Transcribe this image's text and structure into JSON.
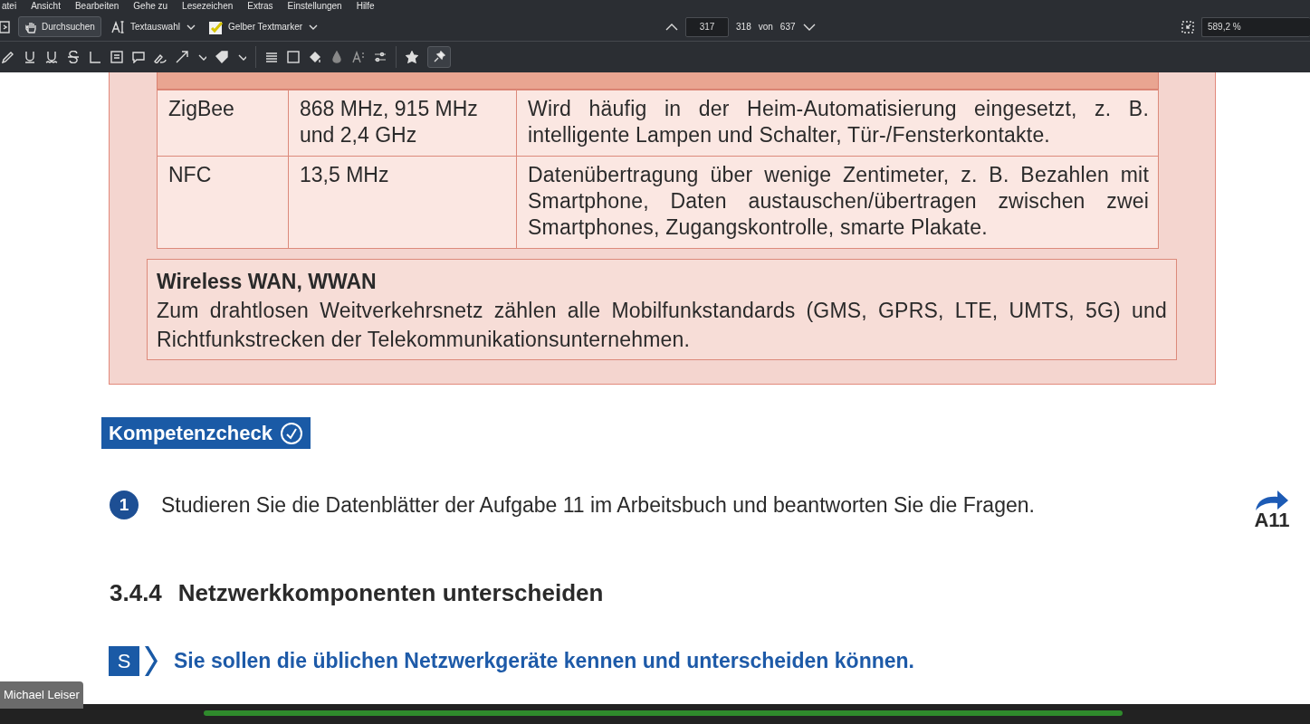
{
  "menu": [
    "atei",
    "Ansicht",
    "Bearbeiten",
    "Gehe zu",
    "Lesezeichen",
    "Extras",
    "Einstellungen",
    "Hilfe"
  ],
  "toolbar": {
    "browse": {
      "label": "Durchsuchen",
      "selected": true
    },
    "text_select": {
      "label": "Textauswahl"
    },
    "highlighter": {
      "label": "Gelber Textmarker"
    },
    "page_field": {
      "value": "317"
    },
    "page_number": "318",
    "page_of": "von",
    "page_total": "637",
    "zoom_field": {
      "value": "589,2 %"
    }
  },
  "annotation_bar": {
    "pin_selected": true
  },
  "table": {
    "rows": [
      {
        "cells": [
          "ZigBee",
          "868 MHz, 915 MHz und 2,4 GHz",
          "Wird häufig in der Heim-Automatisierung eingesetzt, z. B. intelligente Lampen und Schalter, Tür-/Fensterkontakte."
        ]
      },
      {
        "cells": [
          "NFC",
          "13,5 MHz",
          "Datenübertragung über wenige Zentimeter, z. B. Bezahlen mit Smartphone, Daten austauschen/übertragen zwischen zwei Smartphones, Zugangskontrolle, smarte Plakate."
        ]
      }
    ]
  },
  "wwan": {
    "title": "Wireless WAN, WWAN",
    "text": "Zum drahtlosen Weitverkehrsnetz zählen alle Mobilfunkstandards (GMS, GPRS, LTE, UMTS, 5G) und Richtfunkstrecken der Telekommunikationsunternehmen."
  },
  "check": {
    "title": "Kompetenzcheck",
    "tasks": [
      {
        "number": "1",
        "text": "Studieren Sie die Datenblätter der Aufgabe 11 im Arbeitsbuch und beantworten Sie die Fragen.",
        "ref": "A11"
      }
    ]
  },
  "section": {
    "number": "3.4.4",
    "title": "Netzwerkkomponenten unterscheiden",
    "goal_letter": "S",
    "goal": "Sie sollen die üblichen Netzwerkgeräte kennen und unterscheiden können."
  },
  "caption": "Michael Leiser"
}
